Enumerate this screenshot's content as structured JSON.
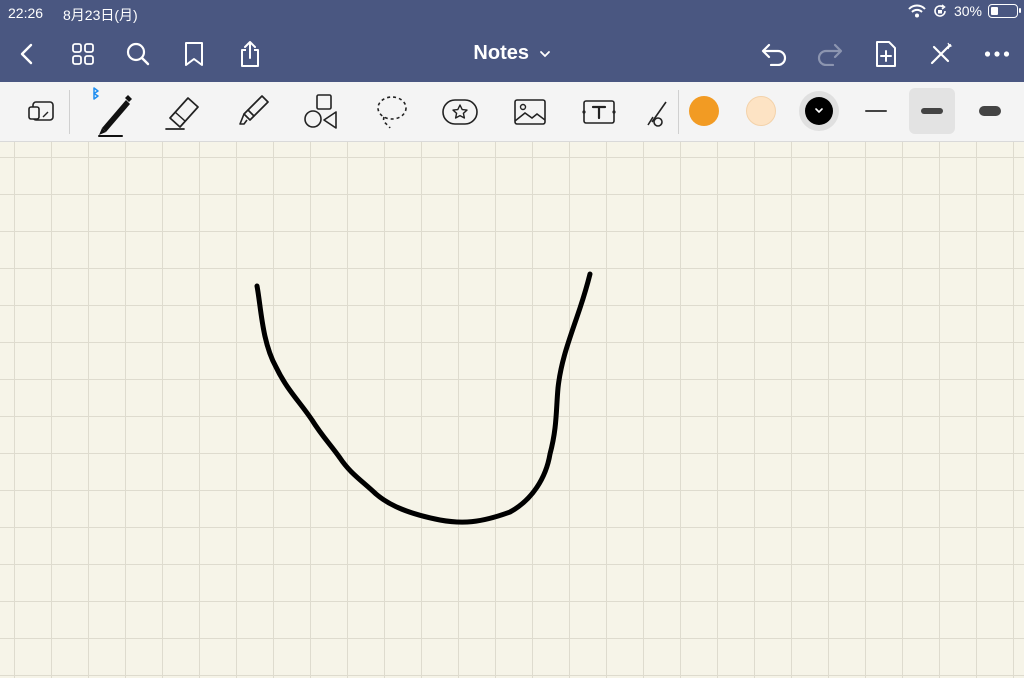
{
  "status_bar": {
    "time": "22:26",
    "date": "8月23日(月)",
    "battery_percent": "30%",
    "battery_level": 0.3,
    "icons": [
      "wifi-icon",
      "orientation-lock-icon",
      "battery-icon"
    ]
  },
  "nav": {
    "title": "Notes",
    "icons": [
      "back-icon",
      "grid-icon",
      "search-icon",
      "bookmark-icon",
      "share-icon",
      "undo-icon",
      "redo-icon",
      "add-page-icon",
      "close-tools-icon",
      "more-icon"
    ]
  },
  "toolbar": {
    "tools": [
      "page-thumbnail-icon",
      "pen-icon",
      "eraser-icon",
      "highlighter-icon",
      "shapes-icon",
      "lasso-icon",
      "sticker-icon",
      "image-icon",
      "text-icon",
      "laser-pointer-icon"
    ],
    "active_tool": "pen",
    "bluetooth_connected": true,
    "colors": [
      "#f29b23",
      "#fde3c4",
      "#000000"
    ],
    "selected_color": "#000000",
    "stroke_widths": [
      "thin",
      "medium",
      "thick"
    ],
    "selected_stroke": "medium"
  },
  "canvas": {
    "paper": "grid",
    "paper_color": "#f6f4e8",
    "ink_color": "#000000"
  }
}
